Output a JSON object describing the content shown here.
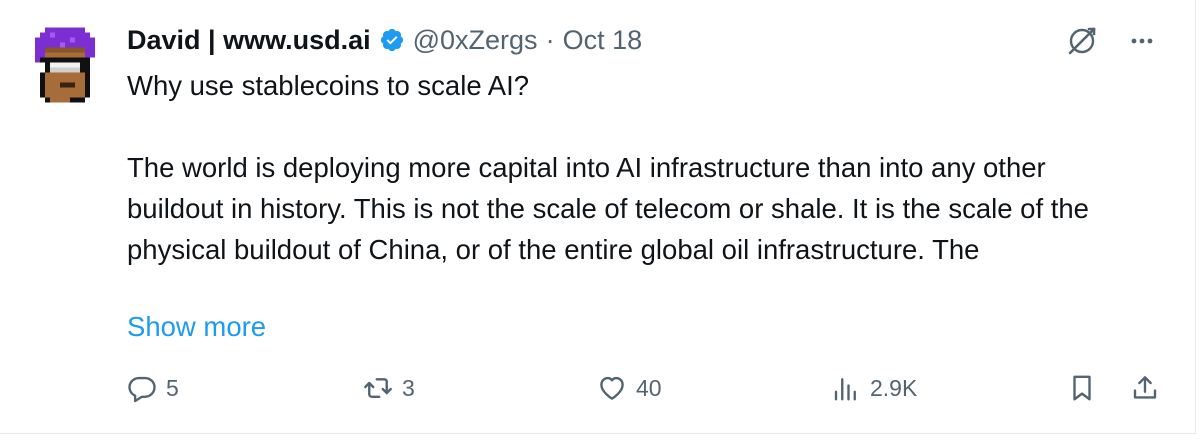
{
  "tweet": {
    "author_name": "David | www.usd.ai",
    "handle": "@0xZergs",
    "separator": "·",
    "date": "Oct 18",
    "body": "Why use stablecoins to scale AI?\n\nThe world is deploying more capital into AI infrastructure than into any other buildout in history. This is not the scale of telecom or shale. It is the scale of the physical buildout of China, or of the entire global oil infrastructure. The",
    "show_more_label": "Show more",
    "reply_count": "5",
    "retweet_count": "3",
    "like_count": "40",
    "view_count": "2.9K",
    "icons": {
      "verified": "verified-badge-icon",
      "grok": "grok-icon",
      "more": "more-icon",
      "reply": "reply-icon",
      "retweet": "retweet-icon",
      "like": "heart-icon",
      "views": "views-icon",
      "bookmark": "bookmark-icon",
      "share": "share-icon"
    }
  },
  "colors": {
    "text": "#0f1419",
    "secondary": "#536471",
    "link": "#1d9bf0",
    "verified": "#1d9bf0",
    "avatar_hair": "#7b2fd3"
  }
}
